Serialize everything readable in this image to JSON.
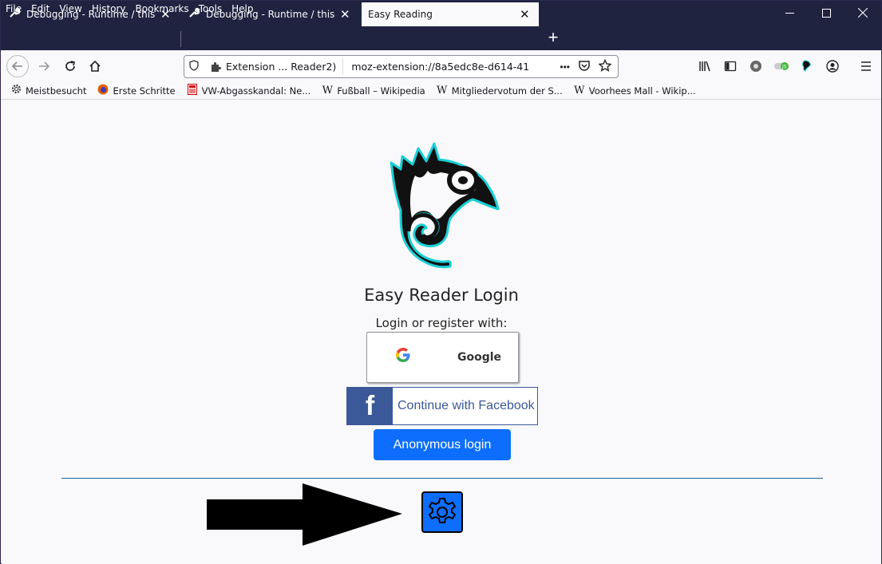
{
  "menu": [
    {
      "label": "File",
      "key": "F"
    },
    {
      "label": "Edit",
      "key": "E"
    },
    {
      "label": "View",
      "key": "V"
    },
    {
      "label": "History",
      "key": "s"
    },
    {
      "label": "Bookmarks",
      "key": "B"
    },
    {
      "label": "Tools",
      "key": "T"
    },
    {
      "label": "Help",
      "key": "H"
    }
  ],
  "window_controls": {
    "minimize": "—",
    "maximize": "☐",
    "close": "✕"
  },
  "tabs": [
    {
      "label": "Debugging - Runtime / this-firefox",
      "close": "✕"
    },
    {
      "label": "Debugging - Runtime / this-firefox",
      "close": "✕"
    },
    {
      "label": "Easy Reading",
      "close": "✕"
    }
  ],
  "newtab": "+",
  "urlbar": {
    "extension_label": "Extension ... Reader2)",
    "url": "moz-extension://8a5edc8e-d614-41",
    "more": "•••"
  },
  "bookmarks": [
    {
      "label": "Meistbesucht",
      "icon": "gear-icon"
    },
    {
      "label": "Erste Schritte",
      "icon": "firefox-icon"
    },
    {
      "label": "VW-Abgasskandal: Ne...",
      "icon": "news-icon"
    },
    {
      "label": "Fußball – Wikipedia",
      "icon": "wikipedia-icon"
    },
    {
      "label": "Mitgliedervotum der S...",
      "icon": "wikipedia-icon"
    },
    {
      "label": "Voorhees Mall - Wikip...",
      "icon": "wikipedia-icon"
    }
  ],
  "login": {
    "title": "Easy Reader Login",
    "subtitle": "Login or register with:",
    "google_label": "Google",
    "facebook_label": "Continue with Facebook",
    "facebook_icon": "f",
    "anonymous_label": "Anonymous login"
  },
  "colors": {
    "accent": "#0d6efd",
    "facebook": "#3b5998",
    "titlebar": "#202340",
    "logo_outline": "#1bcfd4"
  }
}
